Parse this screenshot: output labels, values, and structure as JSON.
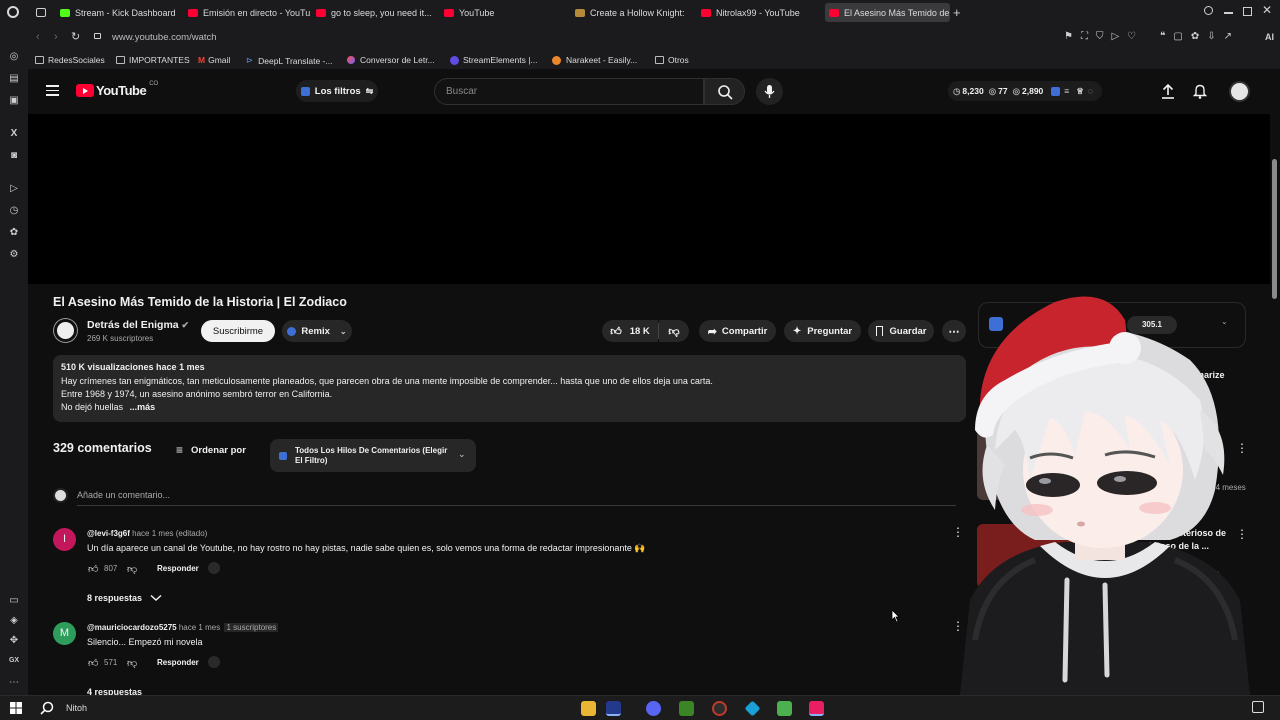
{
  "browser": {
    "tabs": [
      {
        "label": "Stream - Kick Dashboard",
        "color": "#53fc18"
      },
      {
        "label": "Emisión en directo - YouTu",
        "color": "#ff0033"
      },
      {
        "label": "go to sleep, you need it...",
        "color": "#ff0033"
      },
      {
        "label": "YouTube",
        "color": "#ff0033"
      },
      {
        "label": "Create a Hollow Knight: S",
        "color": "#b58a3a"
      },
      {
        "label": "Nitrolax99 - YouTube",
        "color": "#ff0033"
      },
      {
        "label": "El Asesino Más Temido de",
        "color": "#ff0033"
      }
    ],
    "url": "www.youtube.com/watch",
    "bookmarks": [
      "RedesSociales",
      "IMPORTANTES",
      "Gmail",
      "DeepL Translate -...",
      "Conversor de Letr...",
      "StreamElements |...",
      "Narakeet - Easily...",
      "Otros"
    ]
  },
  "youtube": {
    "logo_text": "YouTube",
    "country": "CO",
    "filters_label": "Los filtros",
    "search_placeholder": "Buscar",
    "ext_stats": [
      "8,230",
      "77",
      "2,890"
    ]
  },
  "video": {
    "title": "El Asesino Más Temido de la Historia | El Zodiaco",
    "channel": "Detrás del Enigma",
    "subscribers": "269 K suscriptores",
    "subscribe_label": "Suscribirme",
    "remix_label": "Remix",
    "likes": "18 K",
    "share_label": "Compartir",
    "ask_label": "Preguntar",
    "save_label": "Guardar",
    "views": "510 K visualizaciones  hace 1 mes",
    "desc_lines": [
      "Hay crímenes tan enigmáticos, tan meticulosamente planeados, que parecen obra de una mente imposible de comprender... hasta que uno de ellos deja una carta.",
      "Entre 1968 y 1974, un asesino anónimo sembró terror en California.",
      "No dejó huellas"
    ],
    "more_label": "...más"
  },
  "comments": {
    "count": "329 comentarios",
    "sort_label": "Ordenar por",
    "filter_label_1": "Todos Los Hilos De Comentarios (Elegir",
    "filter_label_2": "El Filtro)",
    "add_placeholder": "Añade un comentario...",
    "items": [
      {
        "avatar_letter": "I",
        "avatar_color": "#c2185b",
        "user": "@levi-f3g6f",
        "meta": "hace 1 mes (editado)",
        "badge": "",
        "text": "Un día aparece un canal de Youtube, no hay rostro no hay pistas, nadie sabe quien es,  solo vemos una forma de redactar impresionante 🙌",
        "likes": "807",
        "reply_label": "Responder",
        "replies": "8 respuestas"
      },
      {
        "avatar_letter": "M",
        "avatar_color": "#2e9d5c",
        "user": "@mauriciocardozo5275",
        "meta": "hace 1 mes",
        "badge": "1 suscriptores",
        "text": "Silencio... Empezó mi novela",
        "likes": "571",
        "reply_label": "Responder",
        "replies": "4 respuestas"
      }
    ]
  },
  "right_panel": {
    "stat": "305.1",
    "summarize": "mmarize",
    "rec_meta": "hace 4 meses",
    "rec_title_1": "Más Misterioso de",
    "rec_title_2": "| El Caso de la ...",
    "rec_meta_2": "mes"
  },
  "taskbar": {
    "search_label": "Nitoh"
  },
  "colors": {
    "youtube_red": "#ff0033",
    "background": "#0f0f0f",
    "chip": "#272727"
  }
}
